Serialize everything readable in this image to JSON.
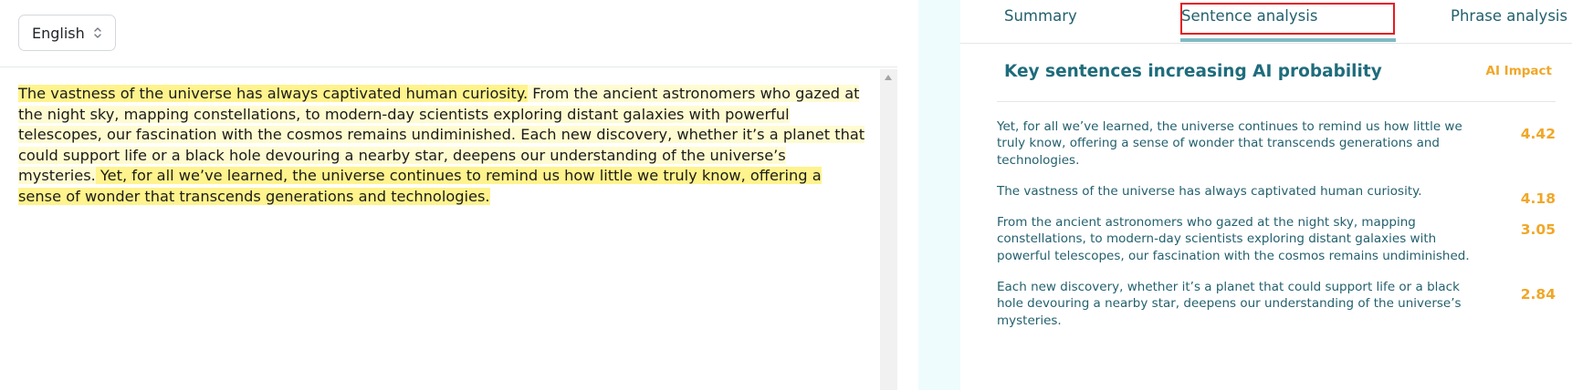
{
  "language_select": {
    "value": "English"
  },
  "editor": {
    "sentences": [
      "The vastness of the universe has always captivated human curiosity.",
      " From the ancient astronomers who gazed at the night sky, mapping constellations, to modern-day scientists exploring distant galaxies with powerful telescopes, our fascination with the cosmos remains undiminished.",
      " Each new discovery, whether it’s a planet that could support life or a black hole devouring a nearby star, deepens our understanding of the universe’s mysteries.",
      " Yet, for all we’ve learned, the universe continues to remind us how little we truly know, offering a sense of wonder that transcends generations and technologies."
    ]
  },
  "tabs": [
    {
      "label": "Summary"
    },
    {
      "label": "Sentence analysis",
      "active": true
    },
    {
      "label": "Phrase analysis"
    }
  ],
  "panel": {
    "title": "Key sentences increasing AI probability",
    "impact_label": "AI Impact",
    "items": [
      {
        "text": "Yet, for all we’ve learned, the universe continues to remind us how little we truly know, offering a sense of wonder that transcends generations and technologies.",
        "score": "4.42"
      },
      {
        "text": "The vastness of the universe has always captivated human curiosity.",
        "score": "4.18"
      },
      {
        "text": "From the ancient astronomers who gazed at the night sky, mapping constellations, to modern-day scientists exploring distant galaxies with powerful telescopes, our fascination with the cosmos remains undiminished.",
        "score": "3.05"
      },
      {
        "text": "Each new discovery, whether it’s a planet that could support life or a black hole devouring a nearby star, deepens our understanding of the universe’s mysteries.",
        "score": "2.84"
      }
    ]
  },
  "colors": {
    "accent_teal": "#1f6c7c",
    "impact_orange": "#f0a728",
    "highlight_strong": "#fff38d",
    "highlight_light": "#fffbd1",
    "active_tab_outline": "#e31b23"
  }
}
